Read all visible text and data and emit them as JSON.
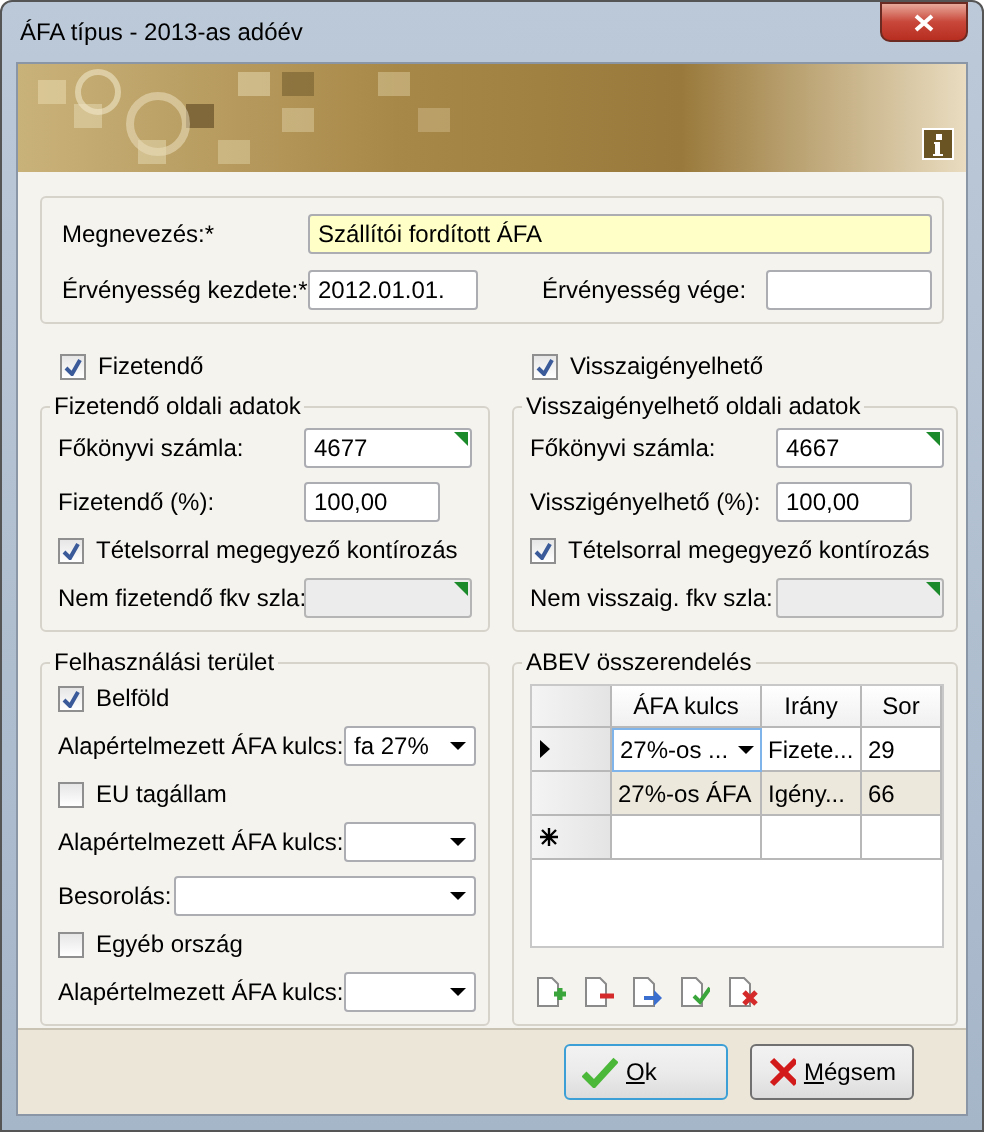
{
  "window": {
    "title": "ÁFA típus - 2013-as adóév"
  },
  "general": {
    "fields": [
      {
        "label": "Megnevezés:*",
        "value": "Szállítói fordított ÁFA",
        "highlighted": true
      },
      {
        "label": "Érvényesség kezdete:*",
        "value": "2012.01.01.",
        "highlighted": false
      },
      {
        "label": "Érvényesség vége:",
        "highlighted": false
      }
    ]
  },
  "sides": [
    {
      "checkbox": {
        "label": "Fizetendő",
        "checked": true
      },
      "title": "Fizetendő oldali adatok",
      "items": [
        {
          "kind": "lookup",
          "label": "Főkönyvi számla:",
          "value": "4677",
          "disabled": false
        },
        {
          "kind": "text",
          "label": "Fizetendő (%):",
          "value": "100,00"
        },
        {
          "kind": "checkbox",
          "label": "Tételsorral megegyező kontírozás",
          "checked": true
        },
        {
          "kind": "lookup",
          "label": "Nem fizetendő fkv szla:",
          "disabled": true
        }
      ]
    },
    {
      "checkbox": {
        "label": "Visszaigényelhető",
        "checked": true
      },
      "title": "Visszaigényelhető oldali adatok",
      "items": [
        {
          "kind": "lookup",
          "label": "Főkönyvi számla:",
          "value": "4667",
          "disabled": false
        },
        {
          "kind": "text",
          "label": "Visszigényelhető (%):",
          "value": "100,00"
        },
        {
          "kind": "checkbox",
          "label": "Tételsorral megegyező kontírozás",
          "checked": true
        },
        {
          "kind": "lookup",
          "label": "Nem visszaig. fkv szla:",
          "disabled": true
        }
      ]
    }
  ],
  "usage": {
    "title": "Felhasználási terület",
    "items": [
      {
        "kind": "checkbox",
        "label": "Belföld",
        "checked": true
      },
      {
        "kind": "select",
        "label": "Alapértelmezett ÁFA kulcs:",
        "value": "fa 27%"
      },
      {
        "kind": "checkbox",
        "label": "EU tagállam",
        "checked": false
      },
      {
        "kind": "select",
        "label": "Alapértelmezett ÁFA kulcs:"
      },
      {
        "kind": "wide-select",
        "label": "Besorolás:"
      },
      {
        "kind": "checkbox",
        "label": "Egyéb ország",
        "checked": false
      },
      {
        "kind": "select",
        "label": "Alapértelmezett ÁFA kulcs:"
      }
    ]
  },
  "abev": {
    "title": "ABEV összerendelés",
    "columns": [
      "ÁFA kulcs",
      "Irány",
      "Sor"
    ],
    "rows": [
      {
        "cells": [
          "27%-os ...",
          "Fizete...",
          "29"
        ],
        "selected": true
      },
      {
        "cells": [
          "27%-os ÁFA",
          "Igény...",
          "66"
        ],
        "selected": false
      }
    ]
  },
  "buttons": [
    {
      "kind": "ok",
      "label": "Ok",
      "default": true
    },
    {
      "kind": "cancel",
      "label": "Mégsem",
      "default": false
    }
  ]
}
